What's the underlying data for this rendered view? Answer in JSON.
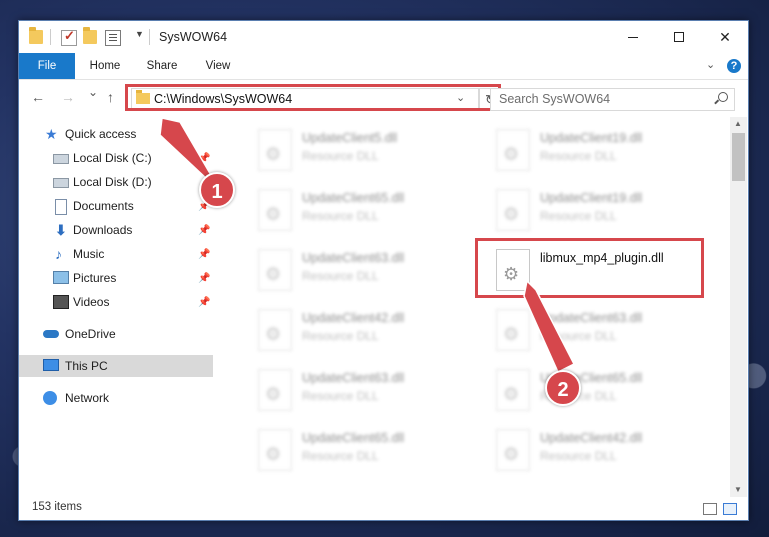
{
  "window": {
    "title": "SysWOW64",
    "controls": {
      "minimize": "",
      "maximize": "",
      "close": "✕"
    }
  },
  "ribbon": {
    "tabs": [
      "File",
      "Home",
      "Share",
      "View"
    ],
    "help": "?"
  },
  "nav": {
    "back": "←",
    "forward": "→",
    "recent": "⌄",
    "up": "↑",
    "address": "C:\\Windows\\SysWOW64",
    "refresh": "↻",
    "search_placeholder": "Search SysWOW64"
  },
  "sidebar": {
    "items": [
      {
        "label": "Quick access",
        "icon": "star-icon"
      },
      {
        "label": "Local Disk (C:)",
        "icon": "drive-icon",
        "pinned": true
      },
      {
        "label": "Local Disk (D:)",
        "icon": "drive-icon",
        "pinned": false
      },
      {
        "label": "Documents",
        "icon": "documents-icon",
        "pinned": true
      },
      {
        "label": "Downloads",
        "icon": "download-icon",
        "pinned": true
      },
      {
        "label": "Music",
        "icon": "music-icon",
        "pinned": true
      },
      {
        "label": "Pictures",
        "icon": "pictures-icon",
        "pinned": true
      },
      {
        "label": "Videos",
        "icon": "videos-icon",
        "pinned": true
      },
      {
        "label": "OneDrive",
        "icon": "onedrive-icon"
      },
      {
        "label": "This PC",
        "icon": "pc-icon",
        "selected": true
      },
      {
        "label": "Network",
        "icon": "network-icon"
      }
    ]
  },
  "files": {
    "left_column": [
      {
        "name": "UpdateClient5.dll",
        "type": "Resource DLL"
      },
      {
        "name": "UpdateClient65.dll",
        "type": "Resource DLL"
      },
      {
        "name": "UpdateClient63.dll",
        "type": "Resource DLL"
      },
      {
        "name": "UpdateClient42.dll",
        "type": "Resource DLL"
      },
      {
        "name": "UpdateClient63.dll",
        "type": "Resource DLL"
      },
      {
        "name": "UpdateClient65.dll",
        "type": "Resource DLL"
      }
    ],
    "right_column": [
      {
        "name": "UpdateClient19.dll",
        "type": "Resource DLL"
      },
      {
        "name": "UpdateClient19.dll",
        "type": "Resource DLL"
      },
      {
        "name": "libmux_mp4_plugin.dll",
        "type": ""
      },
      {
        "name": "UpdateClient63.dll",
        "type": "Resource DLL"
      },
      {
        "name": "UpdateClient65.dll",
        "type": "Resource DLL"
      },
      {
        "name": "UpdateClient42.dll",
        "type": "Resource DLL"
      }
    ]
  },
  "status": {
    "item_count": "153 items"
  },
  "annotations": {
    "callout_1": "1",
    "callout_2": "2",
    "color": "#d6474c"
  }
}
